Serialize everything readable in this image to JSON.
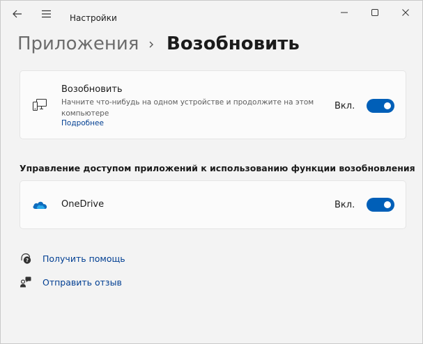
{
  "window": {
    "app_title": "Настройки",
    "icons": {
      "back": "back-arrow-icon",
      "menu": "hamburger-menu-icon",
      "minimize": "minimize-icon",
      "maximize": "maximize-icon",
      "close": "close-icon"
    }
  },
  "breadcrumb": {
    "parent": "Приложения",
    "separator_icon": "chevron-right-icon",
    "current": "Возобновить"
  },
  "resume_card": {
    "icon": "devices-icon",
    "title": "Возобновить",
    "description": "Начните что-нибудь на одном устройстве и продолжите на этом компьютере",
    "link": "Подробнее",
    "state_label": "Вкл.",
    "toggle_on": true
  },
  "app_access": {
    "section_title": "Управление доступом приложений к использованию функции возобновления",
    "apps": [
      {
        "icon": "onedrive-cloud-icon",
        "name": "OneDrive",
        "state_label": "Вкл.",
        "toggle_on": true
      }
    ]
  },
  "footer_links": [
    {
      "icon": "help-chat-icon",
      "label": "Получить помощь"
    },
    {
      "icon": "feedback-person-icon",
      "label": "Отправить отзыв"
    }
  ],
  "colors": {
    "accent": "#005fb8",
    "link": "#003e92",
    "background": "#f3f3f3",
    "card": "#fbfbfb"
  }
}
